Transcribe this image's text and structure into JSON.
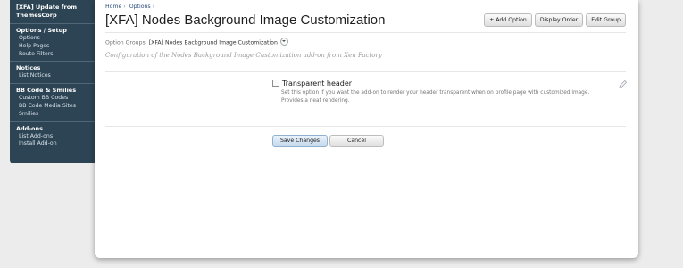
{
  "sidebar": {
    "top_label": "[XFA] Update from ThemesCorp",
    "sections": [
      {
        "heading": "Options / Setup",
        "items": [
          "Options",
          "Help Pages",
          "Route Filters"
        ]
      },
      {
        "heading": "Notices",
        "items": [
          "List Notices"
        ]
      },
      {
        "heading": "BB Code & Smilies",
        "items": [
          "Custom BB Codes",
          "BB Code Media Sites",
          "Smilies"
        ]
      },
      {
        "heading": "Add-ons",
        "items": [
          "List Add-ons",
          "Install Add-on"
        ]
      }
    ]
  },
  "breadcrumb": {
    "items": [
      "Home",
      "Options"
    ],
    "separator": "›"
  },
  "page": {
    "title": "[XFA] Nodes Background Image Customization",
    "buttons": {
      "add_option": "+ Add Option",
      "display_order": "Display Order",
      "edit_group": "Edit Group"
    },
    "option_groups": {
      "label": "Option Groups:",
      "value": "[XFA] Nodes Background Image Customization"
    },
    "description": "Configuration of the Nodes Background Image Customization add-on from Xen Factory"
  },
  "option": {
    "label": "Transparent header",
    "checked": false,
    "hint_line1": "Set this option if you want the add-on to render your header transparent when on profile page with customized image.",
    "hint_line2": "Provides a neat rendering.",
    "edit_icon": "pencil-icon"
  },
  "actions": {
    "save": "Save Changes",
    "cancel": "Cancel"
  }
}
